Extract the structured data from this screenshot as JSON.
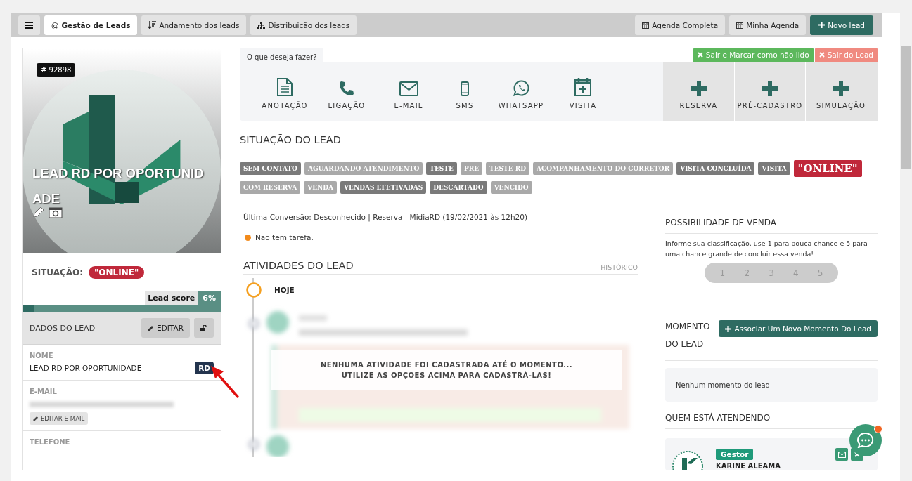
{
  "top_bar": {
    "tabs": [
      {
        "icon_char": "@",
        "label": "Gestão de Leads",
        "selected": true
      },
      {
        "label": "Andamento dos leads",
        "selected": false
      },
      {
        "label": "Distribuição dos leads",
        "selected": false
      }
    ],
    "buttons": [
      {
        "label": "Agenda Completa",
        "kind": "plain"
      },
      {
        "label": "Minha Agenda",
        "kind": "plain"
      },
      {
        "label": "Novo lead",
        "kind": "primary"
      }
    ]
  },
  "lead_card": {
    "id_badge": "# 92898",
    "name": "LEAD RD POR OPORTUNIDADE",
    "situation_label": "SITUAÇÃO:",
    "situation": "\"ONLINE\"",
    "lead_score": {
      "label": "Lead score",
      "reading": "6%",
      "level": 0.06
    }
  },
  "lead_data": {
    "title": "DADOS DO LEAD",
    "edit_button": "EDITAR",
    "fields": [
      {
        "label": "NOME",
        "value": "LEAD RD POR OPORTUNIDADE",
        "badge": "RD"
      },
      {
        "label": "E-MAIL",
        "button": "EDITAR E-MAIL"
      },
      {
        "label": "TELEFONE"
      }
    ]
  },
  "actions": {
    "prompt": "O que deseja fazer?",
    "exit_buttons": [
      {
        "label": "Sair e Marcar como não lido",
        "kind": "success"
      },
      {
        "label": "Sair do Lead",
        "kind": "danger"
      }
    ],
    "items": [
      {
        "label": "ANOTAÇÃO"
      },
      {
        "label": "LIGAÇÃO"
      },
      {
        "label": "E-MAIL"
      },
      {
        "label": "SMS"
      },
      {
        "label": "WHATSAPP"
      },
      {
        "label": "VISITA"
      }
    ],
    "extra_items": [
      {
        "label": "RESERVA"
      },
      {
        "label": "PRÉ-CADASTRO"
      },
      {
        "label": "SIMULAÇÃO"
      }
    ]
  },
  "status": {
    "title": "SITUAÇÃO DO LEAD",
    "tags": [
      {
        "label": "SEM CONTATO",
        "kind": "active"
      },
      {
        "label": "AGUARDANDO ATENDIMENTO",
        "kind": "inactive"
      },
      {
        "label": "TESTE",
        "kind": "active"
      },
      {
        "label": "PRE",
        "kind": "inactive"
      },
      {
        "label": "TESTE RD",
        "kind": "inactive"
      },
      {
        "label": "ACOMPANHAMENTO DO CORRETOR",
        "kind": "inactive"
      },
      {
        "label": "VISITA CONCLUÍDA",
        "kind": "active"
      },
      {
        "label": "VISITA",
        "kind": "active"
      },
      {
        "label": "\"ONLINE\"",
        "kind": "current"
      },
      {
        "label": "COM RESERVA",
        "kind": "inactive"
      },
      {
        "label": "VENDA",
        "kind": "inactive"
      },
      {
        "label": "VENDAS EFETIVADAS",
        "kind": "active"
      },
      {
        "label": "DESCARTADO",
        "kind": "active"
      },
      {
        "label": "VENCIDO",
        "kind": "inactive"
      }
    ]
  },
  "last_conversion": "Última Conversão: Desconhecido | Reserva | MidiaRD (19/02/2021 às 12h20)",
  "task": "Não tem tarefa.",
  "activities": {
    "title": "ATIVIDADES DO LEAD",
    "history_link": "HISTÓRICO",
    "today": "HOJE",
    "empty_message": "NENHUMA ATIVIDADE FOI CADASTRADA ATÉ O MOMENTO...\nUTILIZE AS OPÇÕES ACIMA PARA CADASTRÁ-LAS!"
  },
  "sale_possibility": {
    "title": "POSSIBILIDADE DE VENDA",
    "hint": "Informe sua classificação, use 1 para pouca chance e 5 para uma chance grande de concluir essa venda!",
    "rating": {
      "options": [
        "1",
        "2",
        "3",
        "4",
        "5"
      ],
      "stars": 0
    }
  },
  "moment": {
    "title": "MOMENTO DO LEAD",
    "button": "Associar Um Novo Momento Do Lead",
    "empty": "Nenhum momento do lead"
  },
  "attending": {
    "title": "QUEM ESTÁ ATENDENDO",
    "people": [
      {
        "role": "Gestor",
        "name": "KARINE ALEAMA"
      }
    ]
  }
}
